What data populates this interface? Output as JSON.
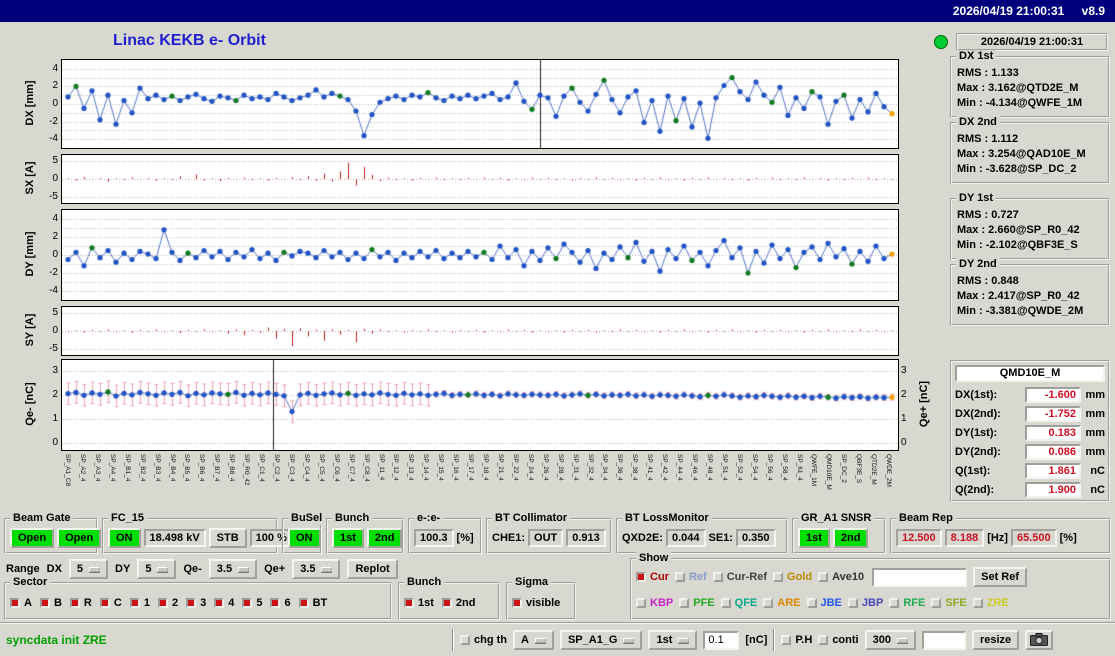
{
  "titlebar": {
    "text": "2026/04/19 21:00:31",
    "version": "v8.9"
  },
  "header": {
    "title": "Linac KEKB e- Orbit",
    "timestamp": "2026/04/19 21:00:31"
  },
  "stats": [
    {
      "title": "DX 1st",
      "lines": [
        "RMS : 1.133",
        "Max : 3.162@QTD2E_M",
        "Min : -4.134@QWFE_1M"
      ]
    },
    {
      "title": "DX 2nd",
      "lines": [
        "RMS : 1.112",
        "Max : 3.254@QAD10E_M",
        "Min : -3.628@SP_DC_2"
      ]
    },
    {
      "title": "DY 1st",
      "lines": [
        "RMS : 0.727",
        "Max : 2.660@SP_R0_42",
        "Min : -2.102@QBF3E_S"
      ]
    },
    {
      "title": "DY 2nd",
      "lines": [
        "RMS : 0.848",
        "Max : 2.417@SP_R0_42",
        "Min : -3.381@QWDE_2M"
      ]
    }
  ],
  "readout": {
    "title": "QMD10E_M",
    "rows": [
      {
        "label": "DX(1st):",
        "value": "-1.600",
        "unit": "mm"
      },
      {
        "label": "DX(2nd):",
        "value": "-1.752",
        "unit": "mm"
      },
      {
        "label": "DY(1st):",
        "value": "0.183",
        "unit": "mm"
      },
      {
        "label": "DY(2nd):",
        "value": "0.086",
        "unit": "mm"
      },
      {
        "label": "Q(1st):",
        "value": "1.861",
        "unit": "nC"
      },
      {
        "label": "Q(2nd):",
        "value": "1.900",
        "unit": "nC"
      }
    ]
  },
  "panels": {
    "beam_gate": {
      "title": "Beam Gate",
      "open1": "Open",
      "open2": "Open"
    },
    "fc15": {
      "title": "FC_15",
      "on": "ON",
      "kv": "18.498 kV",
      "stb": "STB",
      "pct": "100 %"
    },
    "busel": {
      "title": "BuSel",
      "on": "ON"
    },
    "bunch": {
      "title": "Bunch",
      "b1": "1st",
      "b2": "2nd"
    },
    "ee": {
      "title": "e-:e-",
      "value": "100.3",
      "unit": "[%]"
    },
    "bt_col": {
      "title": "BT Collimator",
      "che1": "CHE1:",
      "out": "OUT",
      "val": "0.913"
    },
    "bt_loss": {
      "title": "BT LossMonitor",
      "qxd2e": "QXD2E:",
      "qxd2e_val": "0.044",
      "se1": "SE1:",
      "se1_val": "0.350"
    },
    "gr_a1": {
      "title": "GR_A1 SNSR",
      "b1": "1st",
      "b2": "2nd"
    },
    "beam_rep": {
      "title": "Beam Rep",
      "v1": "12.500",
      "v2": "8.188",
      "hz": "[Hz]",
      "v3": "65.500",
      "pct": "[%]"
    }
  },
  "range_row": {
    "label": "Range",
    "dx": "DX",
    "dx_val": "5",
    "dy": "DY",
    "dy_val": "5",
    "qem": "Qe-",
    "qem_val": "3.5",
    "qep": "Qe+",
    "qep_val": "3.5",
    "replot": "Replot"
  },
  "sector": {
    "title": "Sector",
    "items": [
      {
        "label": "A",
        "checked": true
      },
      {
        "label": "B",
        "checked": true
      },
      {
        "label": "R",
        "checked": true
      },
      {
        "label": "C",
        "checked": true
      },
      {
        "label": "1",
        "checked": true
      },
      {
        "label": "2",
        "checked": true
      },
      {
        "label": "3",
        "checked": true
      },
      {
        "label": "4",
        "checked": true
      },
      {
        "label": "5",
        "checked": true
      },
      {
        "label": "6",
        "checked": true
      },
      {
        "label": "BT",
        "checked": true
      }
    ]
  },
  "bunch2": {
    "title": "Bunch",
    "items": [
      {
        "label": "1st",
        "checked": true
      },
      {
        "label": "2nd",
        "checked": true
      }
    ]
  },
  "sigma": {
    "title": "Sigma",
    "items": [
      {
        "label": "visible",
        "checked": true
      }
    ]
  },
  "show": {
    "title": "Show",
    "row1": [
      {
        "label": "Cur",
        "color": "#aa0000",
        "checked": true
      },
      {
        "label": "Ref",
        "color": "#8899cc",
        "checked": false
      },
      {
        "label": "Cur-Ref",
        "color": "#404040",
        "checked": false
      },
      {
        "label": "Gold",
        "color": "#bb8800",
        "checked": false
      },
      {
        "label": "Ave10",
        "color": "#333333",
        "checked": false
      }
    ],
    "entry": "",
    "set_ref": "Set Ref",
    "row2": [
      {
        "label": "KBP",
        "color": "#cc22cc",
        "checked": false
      },
      {
        "label": "PFE",
        "color": "#22aa22",
        "checked": false
      },
      {
        "label": "QFE",
        "color": "#00aa88",
        "checked": false
      },
      {
        "label": "ARE",
        "color": "#dd8800",
        "checked": false
      },
      {
        "label": "JBE",
        "color": "#2255ee",
        "checked": false
      },
      {
        "label": "JBP",
        "color": "#4444bb",
        "checked": false
      },
      {
        "label": "RFE",
        "color": "#22aa55",
        "checked": false
      },
      {
        "label": "SFE",
        "color": "#88aa22",
        "checked": false
      },
      {
        "label": "ZRE",
        "color": "#cccc22",
        "checked": false
      }
    ]
  },
  "statusbar": {
    "message": "syncdata init ZRE",
    "chg_th": "chg th",
    "sel_a": "A",
    "sel_sp": "SP_A1_G",
    "sel_1st": "1st",
    "entry": "0.1",
    "unit": "[nC]",
    "ph": "P.H",
    "conti": "conti",
    "sel_300": "300",
    "entry2": "",
    "resize": "resize"
  },
  "element_names": [
    "SP_A1_C8",
    "SP_A2_4",
    "SP_A3_4",
    "SP_A4_4",
    "SP_B1_4",
    "SP_B2_4",
    "SP_B3_4",
    "SP_B4_4",
    "SP_B5_4",
    "SP_B6_4",
    "SP_B7_4",
    "SP_B8_4",
    "SP_R0_42",
    "SP_C1_4",
    "SP_C2_4",
    "SP_C3_4",
    "SP_C4_4",
    "SP_C5_4",
    "SP_C6_4",
    "SP_C7_4",
    "SP_C8_4",
    "SP_11_4",
    "SP_12_4",
    "SP_13_4",
    "SP_14_4",
    "SP_15_4",
    "SP_16_4",
    "SP_17_4",
    "SP_18_4",
    "SP_21_4",
    "SP_22_4",
    "SP_24_4",
    "SP_26_4",
    "SP_28_4",
    "SP_31_4",
    "SP_32_4",
    "SP_34_4",
    "SP_36_4",
    "SP_38_4",
    "SP_41_4",
    "SP_42_4",
    "SP_44_4",
    "SP_46_4",
    "SP_48_4",
    "SP_51_4",
    "SP_52_4",
    "SP_54_4",
    "SP_56_4",
    "SP_58_4",
    "SP_61_4",
    "QWFE_1M",
    "QMD10E_M",
    "SP_DC_2",
    "QBF3E_S",
    "QTD2E_M",
    "QWDE_2M"
  ],
  "chart_data": [
    {
      "id": "c-dx",
      "type": "scatter",
      "ylabel": "DX [mm]",
      "ylim": [
        -5,
        5
      ],
      "yticks": [
        4,
        2,
        0,
        -2,
        -4
      ],
      "grid": [
        -4,
        -3,
        -2,
        -1,
        0,
        1,
        2,
        3,
        4
      ],
      "cursor": 0.572,
      "point_color": "#2153c4",
      "green_color": "#0f7a1f",
      "line_color": "#5577cc",
      "last_orange": true,
      "xlabels_from": "element_names",
      "greens": [
        1,
        13,
        21,
        34,
        45,
        58,
        63,
        67,
        76,
        83,
        88,
        93,
        97
      ],
      "values": [
        0.8,
        2.0,
        -0.5,
        1.5,
        -1.8,
        1.0,
        -2.3,
        0.4,
        -1.0,
        1.8,
        0.6,
        1.0,
        0.5,
        0.9,
        0.4,
        0.8,
        1.1,
        0.6,
        0.3,
        0.9,
        0.7,
        0.4,
        1.0,
        0.6,
        0.8,
        0.5,
        1.2,
        0.8,
        0.4,
        0.7,
        1.0,
        1.6,
        0.8,
        1.2,
        0.9,
        0.5,
        -0.8,
        -3.6,
        -1.2,
        0.2,
        0.6,
        0.9,
        0.5,
        1.0,
        0.8,
        1.3,
        0.7,
        0.4,
        0.9,
        0.6,
        1.0,
        0.6,
        0.9,
        1.2,
        0.5,
        0.8,
        2.4,
        0.3,
        -0.6,
        1.0,
        0.7,
        -1.4,
        0.9,
        1.8,
        0.2,
        -0.8,
        1.1,
        2.7,
        0.5,
        -1.0,
        0.8,
        1.5,
        -2.1,
        0.4,
        -3.1,
        0.9,
        -1.9,
        0.6,
        -2.6,
        0.1,
        -3.9,
        0.7,
        2.1,
        3.0,
        1.4,
        0.5,
        2.5,
        1.0,
        0.2,
        1.9,
        -1.3,
        0.7,
        -0.5,
        1.4,
        0.8,
        -2.3,
        0.3,
        1.0,
        -1.6,
        0.5,
        -0.9,
        1.2,
        -0.3,
        -1.1
      ]
    },
    {
      "id": "c-sx",
      "type": "spikes",
      "ylabel": "SX [A]",
      "ylim": [
        -6.8,
        6.8
      ],
      "yticks": [
        5,
        0,
        -5
      ],
      "grid": [
        5,
        0,
        -5
      ],
      "color": "#cc2020",
      "xlabels_from": "element_names",
      "values": [
        0.2,
        -0.4,
        0.6,
        -0.2,
        0.3,
        -0.8,
        0.2,
        -0.3,
        0.5,
        -0.2,
        0.3,
        -0.5,
        0.2,
        -0.3,
        0.8,
        -0.2,
        1.3,
        -0.4,
        0.2,
        -0.6,
        0.3,
        -0.2,
        0.4,
        -0.3,
        0.2,
        -0.4,
        0.3,
        -0.2,
        0.5,
        -0.3,
        0.8,
        -0.5,
        1.5,
        -0.8,
        2.2,
        4.6,
        -1.8,
        3.4,
        1.2,
        -0.6,
        0.4,
        -0.3,
        0.2,
        -0.4,
        0.3,
        -0.2,
        0.4,
        -0.3,
        0.2,
        -0.3,
        0.3,
        -0.2,
        0.4,
        -0.2,
        0.3,
        -0.4,
        0.2,
        -0.3,
        0.4,
        -0.2,
        0.3,
        -0.3,
        0.2,
        -0.4,
        0.3,
        -0.2,
        0.4,
        -0.2,
        0.3,
        -0.3,
        0.2,
        -0.4,
        0.3,
        -0.2,
        0.4,
        -0.3,
        0.2,
        -0.4,
        0.3,
        -0.2,
        0.4,
        -0.2,
        0.3,
        -0.3,
        0.2,
        -0.4,
        0.3,
        -0.2,
        0.4,
        -0.3,
        0.2,
        -0.3,
        0.4,
        -0.2,
        0.3,
        -0.4,
        0.2,
        -0.3,
        0.3,
        -0.2,
        0.4,
        -0.3,
        0.2,
        -0.2
      ]
    },
    {
      "id": "c-dy",
      "type": "scatter",
      "ylabel": "DY [mm]",
      "ylim": [
        -5,
        5
      ],
      "yticks": [
        4,
        2,
        0,
        -2,
        -4
      ],
      "grid": [
        -4,
        -3,
        -2,
        -1,
        0,
        1,
        2,
        3,
        4
      ],
      "point_color": "#2153c4",
      "green_color": "#0f7a1f",
      "line_color": "#5577cc",
      "last_orange": true,
      "xlabels_from": "element_names",
      "greens": [
        3,
        15,
        27,
        38,
        52,
        61,
        70,
        78,
        85,
        91,
        98
      ],
      "values": [
        -0.5,
        0.3,
        -1.2,
        0.8,
        -0.3,
        0.5,
        -0.8,
        0.2,
        -0.5,
        0.4,
        0.1,
        -0.4,
        2.8,
        0.3,
        -0.6,
        0.2,
        -0.3,
        0.5,
        -0.2,
        0.4,
        -0.5,
        0.3,
        -0.2,
        0.6,
        -0.4,
        0.2,
        -0.6,
        0.3,
        -0.1,
        0.4,
        0.2,
        -0.3,
        0.5,
        -0.2,
        0.3,
        -0.5,
        0.2,
        -0.4,
        0.6,
        -0.2,
        0.3,
        -0.6,
        0.2,
        -0.3,
        0.4,
        -0.2,
        0.5,
        -0.4,
        0.2,
        -0.3,
        0.4,
        -0.2,
        0.3,
        -0.5,
        1.0,
        -0.3,
        0.6,
        -1.2,
        0.4,
        -0.6,
        0.8,
        -0.4,
        1.2,
        0.3,
        -0.8,
        0.5,
        -1.5,
        0.2,
        -0.5,
        0.9,
        -0.3,
        1.4,
        -0.7,
        0.4,
        -1.8,
        0.6,
        -0.4,
        1.0,
        -0.6,
        0.3,
        -1.2,
        0.5,
        1.6,
        -0.3,
        0.8,
        -2.0,
        0.4,
        -0.9,
        1.1,
        -0.4,
        0.6,
        -1.4,
        0.3,
        0.9,
        -0.5,
        1.3,
        -0.2,
        0.7,
        -1.0,
        0.4,
        -0.7,
        1.0,
        -0.4,
        0.1
      ]
    },
    {
      "id": "c-sy",
      "type": "spikes",
      "ylabel": "SY [A]",
      "ylim": [
        -6.8,
        6.8
      ],
      "yticks": [
        5,
        0,
        -5
      ],
      "grid": [
        5,
        0,
        -5
      ],
      "color": "#cc2020",
      "xlabels_from": "element_names",
      "values": [
        -0.3,
        0.2,
        -0.4,
        0.3,
        -0.2,
        0.4,
        -0.3,
        0.2,
        -0.5,
        0.3,
        -0.2,
        0.4,
        -0.3,
        0.2,
        -0.6,
        0.3,
        -0.2,
        0.5,
        -0.3,
        0.2,
        -0.8,
        0.4,
        -1.2,
        0.3,
        -0.5,
        1.0,
        -2.2,
        0.6,
        -4.3,
        0.8,
        -1.5,
        0.4,
        -2.8,
        0.5,
        -1.0,
        0.3,
        -3.2,
        0.6,
        -0.8,
        0.4,
        -0.3,
        0.2,
        -0.4,
        0.3,
        -0.2,
        0.4,
        -0.3,
        0.2,
        -0.4,
        0.3,
        -0.2,
        0.3,
        -0.4,
        0.2,
        -0.3,
        0.4,
        -0.2,
        0.3,
        -0.4,
        0.2,
        -0.3,
        0.2,
        -0.4,
        0.3,
        -0.2,
        0.3,
        -0.4,
        0.2,
        -0.3,
        0.4,
        -0.2,
        0.3,
        -0.3,
        0.2,
        -0.4,
        0.3,
        -0.2,
        0.4,
        -0.3,
        0.2,
        -0.4,
        0.3,
        -0.2,
        0.4,
        -0.3,
        0.2,
        -0.4,
        0.3,
        -0.2,
        0.3,
        -0.3,
        0.2,
        -0.4,
        0.3,
        -0.2,
        0.4,
        -0.3,
        0.2,
        -0.3,
        0.4,
        -0.2,
        0.3,
        -0.3,
        0.2
      ]
    },
    {
      "id": "c-q",
      "type": "scatter",
      "ylabel": "Qe- [nC]",
      "ylabel_right": "Qe+ [nC]",
      "ylim": [
        -0.3,
        3.45
      ],
      "yticks": [
        3,
        2,
        1,
        0
      ],
      "yticks_right": [
        3,
        2,
        1,
        0
      ],
      "grid": [
        0,
        1,
        2,
        3
      ],
      "cursor": 0.252,
      "point_color": "#2153c4",
      "green_color": "#0f7a1f",
      "line_color": "#5577cc",
      "last_orange": true,
      "xlabels_from": "element_names",
      "errors": {
        "large": 0.45,
        "small": 0.12,
        "split": 46,
        "color": "#f2a2b8"
      },
      "greens": [
        5,
        20,
        35,
        50,
        65,
        80,
        95
      ],
      "values": [
        2.05,
        2.1,
        1.98,
        2.08,
        2.02,
        2.12,
        1.95,
        2.06,
        2.0,
        2.1,
        2.04,
        1.98,
        2.08,
        2.02,
        2.1,
        1.96,
        2.06,
        2.0,
        2.08,
        2.04,
        2.02,
        2.1,
        1.98,
        2.06,
        2.0,
        2.08,
        2.02,
        1.96,
        1.3,
        2.0,
        2.06,
        1.98,
        2.04,
        2.08,
        2.0,
        2.06,
        1.98,
        2.04,
        2.0,
        2.08,
        2.02,
        1.98,
        2.06,
        2.0,
        2.04,
        1.98,
        2.02,
        2.06,
        1.98,
        2.02,
        2.0,
        2.04,
        1.98,
        2.02,
        1.96,
        2.04,
        2.0,
        1.98,
        2.02,
        2.0,
        1.98,
        2.02,
        1.96,
        2.0,
        2.04,
        1.98,
        2.02,
        1.96,
        2.0,
        1.98,
        2.02,
        1.96,
        2.0,
        1.94,
        2.0,
        1.98,
        1.94,
        2.0,
        1.96,
        1.92,
        1.98,
        1.94,
        2.0,
        1.96,
        1.9,
        1.96,
        1.92,
        1.98,
        1.94,
        1.9,
        1.96,
        1.9,
        1.94,
        1.88,
        1.94,
        1.9,
        1.86,
        1.92,
        1.88,
        1.92,
        1.86,
        1.9,
        1.88,
        1.9
      ]
    }
  ]
}
